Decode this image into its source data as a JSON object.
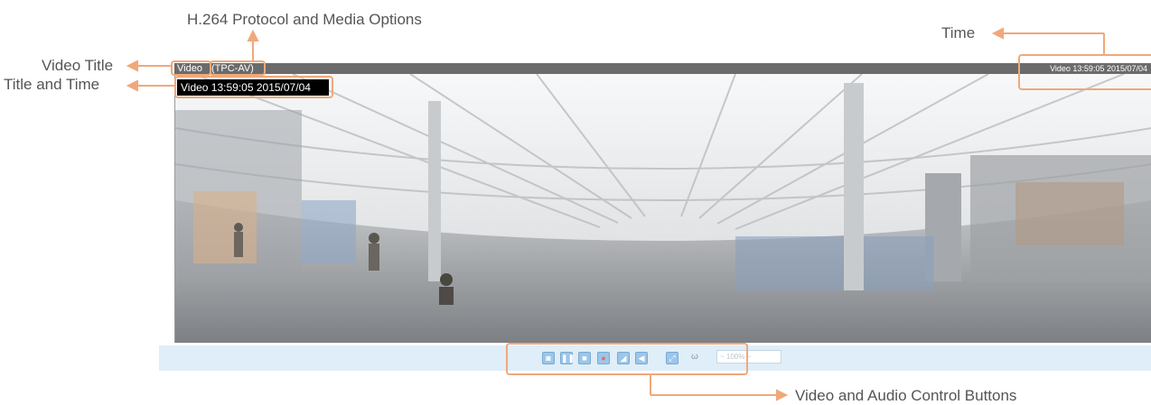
{
  "callouts": {
    "protocol": "H.264 Protocol and Media Options",
    "time": "Time",
    "video_title": "Video Title",
    "title_and_time": "Title and Time",
    "controls": "Video and Audio Control Buttons"
  },
  "viewer": {
    "title": "Video",
    "protocol": "(TPC-AV)",
    "time": "Video 13:59:05  2015/07/04",
    "overlay_time": "Video 13:59:05  2015/07/04"
  },
  "controls": {
    "buttons": [
      "snapshot-icon",
      "pause-icon",
      "stop-icon",
      "record-icon",
      "volume-icon",
      "mute-icon",
      "fullscreen-icon"
    ],
    "zoom_label": "ω",
    "zoom_value": "~ 100% ~"
  },
  "colors": {
    "callout": "#f0a87a",
    "control_strip": "#dfeef8",
    "button": "#9cc6ea"
  }
}
